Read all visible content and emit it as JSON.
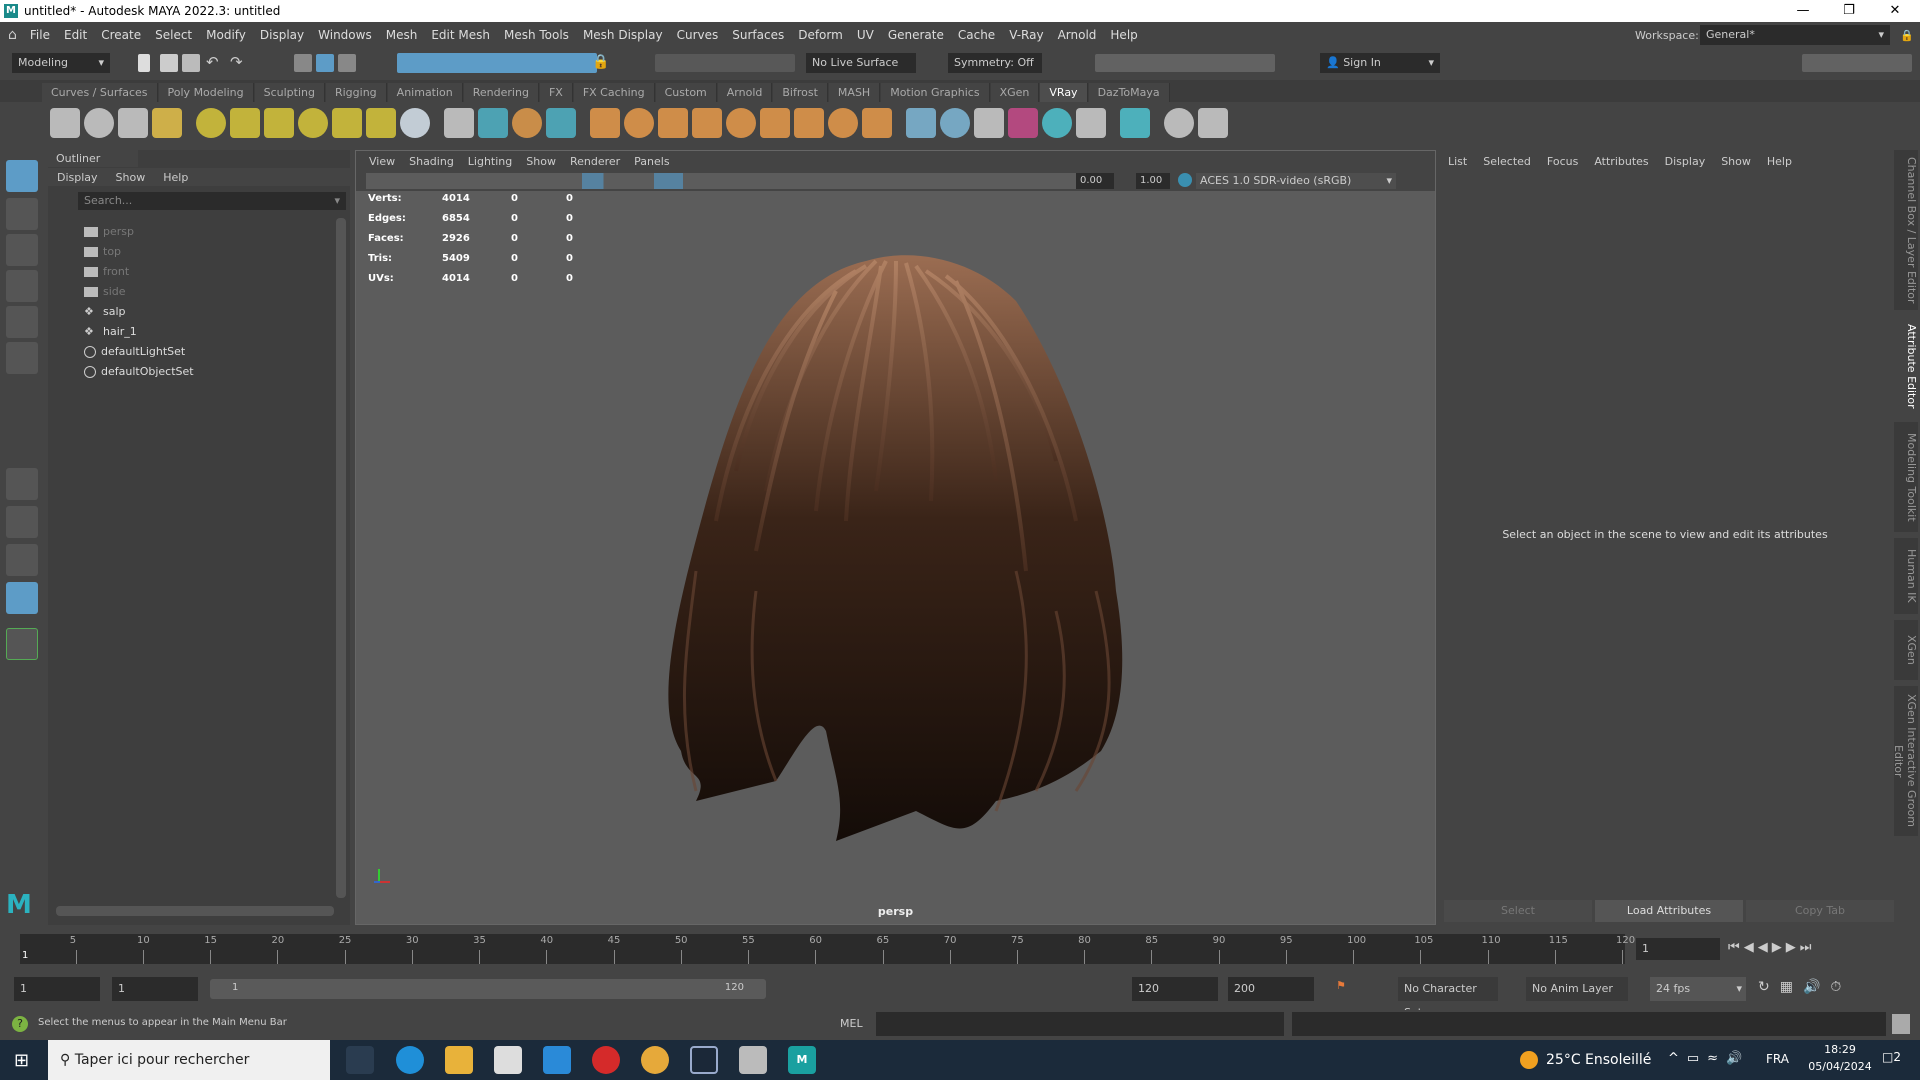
{
  "window": {
    "title": "untitled* - Autodesk MAYA 2022.3: untitled",
    "logo": "M"
  },
  "menubar": [
    "File",
    "Edit",
    "Create",
    "Select",
    "Modify",
    "Display",
    "Windows",
    "Mesh",
    "Edit Mesh",
    "Mesh Tools",
    "Mesh Display",
    "Curves",
    "Surfaces",
    "Deform",
    "UV",
    "Generate",
    "Cache",
    "V-Ray",
    "Arnold",
    "Help"
  ],
  "workspace": {
    "label": "Workspace:",
    "value": "General*"
  },
  "statusline": {
    "mode": "Modeling",
    "live_surface": "No Live Surface",
    "symmetry": "Symmetry: Off",
    "sign_in": "Sign In"
  },
  "shelf_tabs": [
    "Curves / Surfaces",
    "Poly Modeling",
    "Sculpting",
    "Rigging",
    "Animation",
    "Rendering",
    "FX",
    "FX Caching",
    "Custom",
    "Arnold",
    "Bifrost",
    "MASH",
    "Motion Graphics",
    "XGen",
    "VRay",
    "DazToMaya"
  ],
  "active_shelf_tab": "VRay",
  "shelf_icons": [
    {
      "name": "vray-icon",
      "color": "#cfcfcf"
    },
    {
      "name": "vray-sphere-icon",
      "color": "#cfcfcf"
    },
    {
      "name": "vray-render-icon",
      "color": "#cfcfcf"
    },
    {
      "name": "light-bulb-icon",
      "color": "#e6c24a"
    },
    {
      "name": "dome-light-icon",
      "color": "#d8c73a"
    },
    {
      "name": "spot-light-icon",
      "color": "#d8c73a"
    },
    {
      "name": "sphere-light-icon",
      "color": "#d8c73a"
    },
    {
      "name": "mesh-light-icon",
      "color": "#d8c73a"
    },
    {
      "name": "ies-light-icon",
      "color": "#d8c73a"
    },
    {
      "name": "sun-light-icon",
      "color": "#d8c73a"
    },
    {
      "name": "plane-icon",
      "color": "#d8e4ef"
    },
    {
      "name": "proxy-icon",
      "color": "#cfcfcf"
    },
    {
      "name": "proxy-export-icon",
      "color": "#4fb3c7"
    },
    {
      "name": "volume-icon",
      "color": "#e09a4a"
    },
    {
      "name": "fluid-icon",
      "color": "#4fb3c7"
    },
    {
      "name": "material-icon",
      "color": "#e89a4a"
    },
    {
      "name": "displacement-icon",
      "color": "#e89a4a"
    },
    {
      "name": "fur-icon",
      "color": "#e89a4a"
    },
    {
      "name": "texture-icon",
      "color": "#e89a4a"
    },
    {
      "name": "grid-texture-icon",
      "color": "#e89a4a"
    },
    {
      "name": "layered-texture-icon",
      "color": "#e89a4a"
    },
    {
      "name": "shader-ball-icon",
      "color": "#e89a4a"
    },
    {
      "name": "connector-icon",
      "color": "#e89a4a"
    },
    {
      "name": "settings-gear-icon",
      "color": "#e89a4a"
    },
    {
      "name": "object-properties-icon",
      "color": "#7fb8d8"
    },
    {
      "name": "light-select-icon",
      "color": "#7fb8d8"
    },
    {
      "name": "render-element-icon",
      "color": "#cfcfcf"
    },
    {
      "name": "color-sphere-icon",
      "color": "#c74a8a"
    },
    {
      "name": "multi-sphere-icon",
      "color": "#4fc3d0"
    },
    {
      "name": "palette-icon",
      "color": "#cfcfcf"
    },
    {
      "name": "region-icon",
      "color": "#4fc3d0"
    },
    {
      "name": "plugin-icon",
      "color": "#cfcfcf"
    },
    {
      "name": "vray-logo-icon",
      "color": "#cfcfcf"
    }
  ],
  "outliner": {
    "title": "Outliner",
    "menu": [
      "Display",
      "Show",
      "Help"
    ],
    "search_placeholder": "Search...",
    "items": [
      {
        "label": "persp",
        "type": "camera"
      },
      {
        "label": "top",
        "type": "camera"
      },
      {
        "label": "front",
        "type": "camera"
      },
      {
        "label": "side",
        "type": "camera"
      },
      {
        "label": "salp",
        "type": "mesh"
      },
      {
        "label": "hair_1",
        "type": "mesh"
      },
      {
        "label": "defaultLightSet",
        "type": "set"
      },
      {
        "label": "defaultObjectSet",
        "type": "set"
      }
    ]
  },
  "viewport": {
    "menu": [
      "View",
      "Shading",
      "Lighting",
      "Show",
      "Renderer",
      "Panels"
    ],
    "exposure": "0.00",
    "gamma": "1.00",
    "color_space": "ACES 1.0 SDR-video (sRGB)",
    "camera": "persp",
    "hud": [
      {
        "label": "Verts:",
        "a": "4014",
        "b": "0",
        "c": "0"
      },
      {
        "label": "Edges:",
        "a": "6854",
        "b": "0",
        "c": "0"
      },
      {
        "label": "Faces:",
        "a": "2926",
        "b": "0",
        "c": "0"
      },
      {
        "label": "Tris:",
        "a": "5409",
        "b": "0",
        "c": "0"
      },
      {
        "label": "UVs:",
        "a": "4014",
        "b": "0",
        "c": "0"
      }
    ]
  },
  "attribute_editor": {
    "menu": [
      "List",
      "Selected",
      "Focus",
      "Attributes",
      "Display",
      "Show",
      "Help"
    ],
    "message": "Select an object in the scene to view and edit its attributes",
    "buttons": [
      "Select",
      "Load Attributes",
      "Copy Tab"
    ]
  },
  "side_tabs": [
    "Channel Box / Layer Editor",
    "Attribute Editor",
    "Modeling Toolkit",
    "Human IK",
    "XGen",
    "XGen Interactive Groom Editor"
  ],
  "timeline": {
    "ticks": [
      "5",
      "10",
      "15",
      "20",
      "25",
      "30",
      "35",
      "40",
      "45",
      "50",
      "55",
      "60",
      "65",
      "70",
      "75",
      "80",
      "85",
      "90",
      "95",
      "100",
      "105",
      "110",
      "115",
      "120"
    ],
    "current_frame": "1",
    "current_field": "1"
  },
  "range": {
    "start": "1",
    "playback_start": "1",
    "slider_start": "1",
    "slider_end": "120",
    "playback_end": "120",
    "end": "200",
    "character_set": "No Character Set",
    "anim_layer": "No Anim Layer",
    "fps": "24 fps"
  },
  "commandline": {
    "help": "Select the menus to appear in the Main Menu Bar",
    "lang": "MEL"
  },
  "taskbar": {
    "search": "Taper ici pour rechercher",
    "weather": "25°C  Ensoleillé",
    "lang": "FRA",
    "time": "18:29",
    "date": "05/04/2024",
    "notifications": "2"
  },
  "colors": {
    "accent": "#5d9cc7",
    "hair": "#8a5f45",
    "viewport_bg": "#5c5c5c"
  }
}
